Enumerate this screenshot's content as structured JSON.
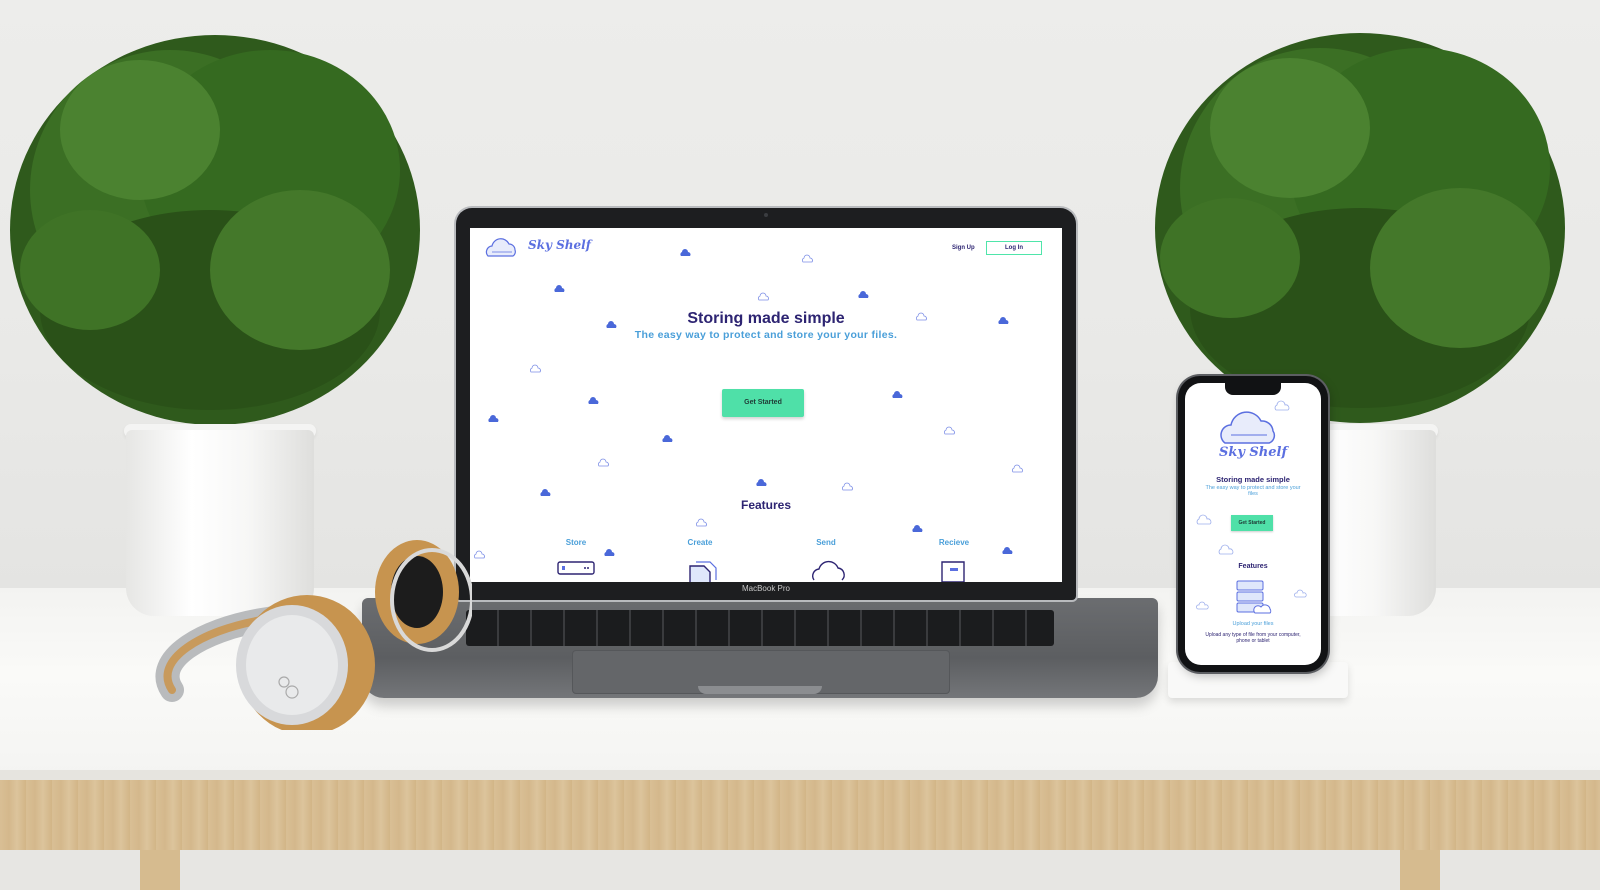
{
  "site": {
    "logo_text": "Sky Shelf",
    "nav": {
      "signup": "Sign Up",
      "login": "Log In"
    },
    "hero": {
      "title": "Storing made simple",
      "subtitle": "The easy way to protect and store your your files.",
      "cta": "Get Started"
    },
    "features": {
      "title": "Features",
      "items": [
        {
          "label": "Store",
          "icon": "server-icon"
        },
        {
          "label": "Create",
          "icon": "document-icon"
        },
        {
          "label": "Send",
          "icon": "cloud-icon"
        },
        {
          "label": "Recieve",
          "icon": "inbox-icon"
        }
      ]
    }
  },
  "laptop": {
    "model_label": "MacBook Pro"
  },
  "mobile": {
    "logo_text": "Sky Shelf",
    "title": "Storing made simple",
    "subtitle": "The easy way to protect and store your files",
    "cta": "Get Started",
    "features_title": "Features",
    "feature_label": "Upload your files",
    "feature_desc": "Upload any type of file from your computer, phone or tablet"
  },
  "colors": {
    "brand_blue": "#5b6fe0",
    "navy": "#2d2472",
    "light_blue": "#4a9fd9",
    "mint": "#4fe0a8"
  }
}
